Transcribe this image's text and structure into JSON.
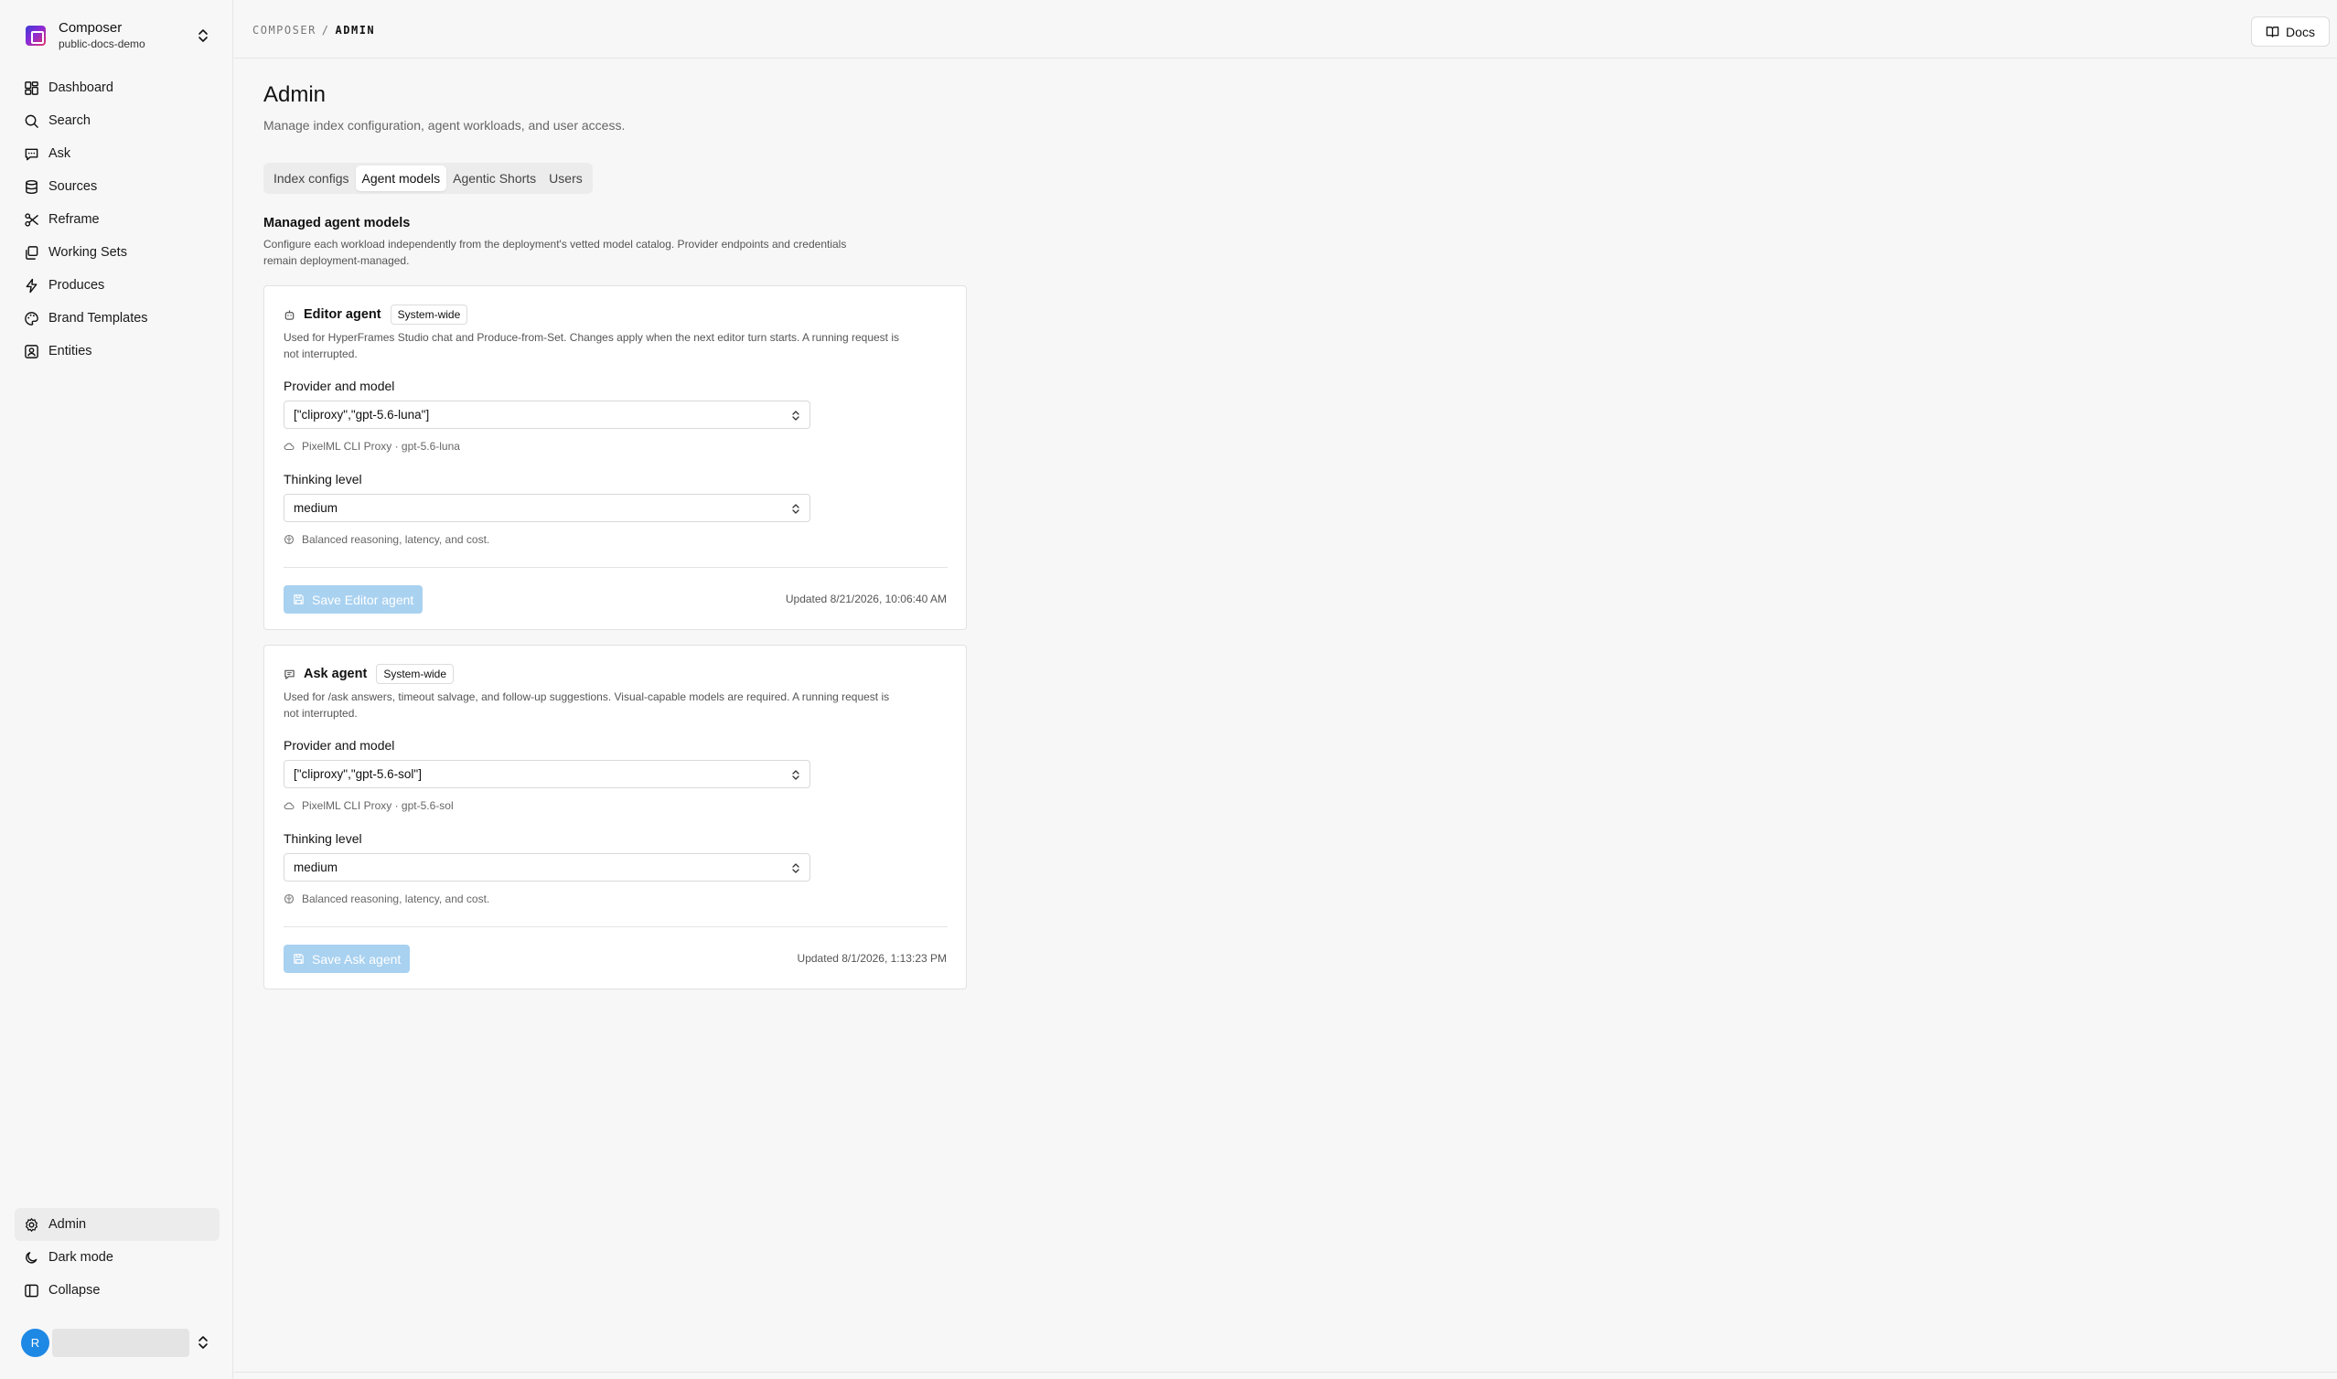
{
  "workspace": {
    "name": "Composer",
    "subtitle": "public-docs-demo"
  },
  "sidebar": {
    "items": [
      {
        "label": "Dashboard",
        "icon": "dashboard-icon"
      },
      {
        "label": "Search",
        "icon": "search-icon"
      },
      {
        "label": "Ask",
        "icon": "chat-icon"
      },
      {
        "label": "Sources",
        "icon": "database-icon"
      },
      {
        "label": "Reframe",
        "icon": "scissors-icon"
      },
      {
        "label": "Working Sets",
        "icon": "layers-icon"
      },
      {
        "label": "Produces",
        "icon": "bolt-icon"
      },
      {
        "label": "Brand Templates",
        "icon": "palette-icon"
      },
      {
        "label": "Entities",
        "icon": "contact-icon"
      }
    ],
    "bottom_items": [
      {
        "label": "Admin",
        "icon": "gear-icon",
        "active": true
      },
      {
        "label": "Dark mode",
        "icon": "moon-icon"
      },
      {
        "label": "Collapse",
        "icon": "sidebar-collapse-icon"
      }
    ],
    "user": {
      "initial": "R"
    }
  },
  "topbar": {
    "breadcrumb": {
      "root": "COMPOSER",
      "separator": "/",
      "current": "ADMIN"
    },
    "docs_label": "Docs"
  },
  "page": {
    "title": "Admin",
    "subtitle": "Manage index configuration, agent workloads, and user access.",
    "tabs": [
      {
        "label": "Index configs"
      },
      {
        "label": "Agent models",
        "active": true
      },
      {
        "label": "Agentic Shorts"
      },
      {
        "label": "Users"
      }
    ],
    "section": {
      "title": "Managed agent models",
      "description": "Configure each workload independently from the deployment's vetted model catalog. Provider endpoints and credentials remain deployment-managed."
    }
  },
  "agents": [
    {
      "title": "Editor agent",
      "icon": "bot-icon",
      "badge": "System-wide",
      "description": "Used for HyperFrames Studio chat and Produce-from-Set. Changes apply when the next editor turn starts. A running request is not interrupted.",
      "provider_label": "Provider and model",
      "provider_value": "[\"cliproxy\",\"gpt-5.6-luna\"]",
      "provider_hint": "PixelML CLI Proxy · gpt-5.6-luna",
      "thinking_label": "Thinking level",
      "thinking_value": "medium",
      "thinking_hint": "Balanced reasoning, latency, and cost.",
      "save_label": "Save Editor agent",
      "updated": "Updated 8/21/2026, 10:06:40 AM"
    },
    {
      "title": "Ask agent",
      "icon": "message-icon",
      "badge": "System-wide",
      "description": "Used for /ask answers, timeout salvage, and follow-up suggestions. Visual-capable models are required. A running request is not interrupted.",
      "provider_label": "Provider and model",
      "provider_value": "[\"cliproxy\",\"gpt-5.6-sol\"]",
      "provider_hint": "PixelML CLI Proxy · gpt-5.6-sol",
      "thinking_label": "Thinking level",
      "thinking_value": "medium",
      "thinking_hint": "Balanced reasoning, latency, and cost.",
      "save_label": "Save Ask agent",
      "updated": "Updated 8/1/2026, 1:13:23 PM"
    }
  ],
  "colors": {
    "accent_disabled": "#a9d1f0",
    "avatar": "#1e88e5"
  }
}
